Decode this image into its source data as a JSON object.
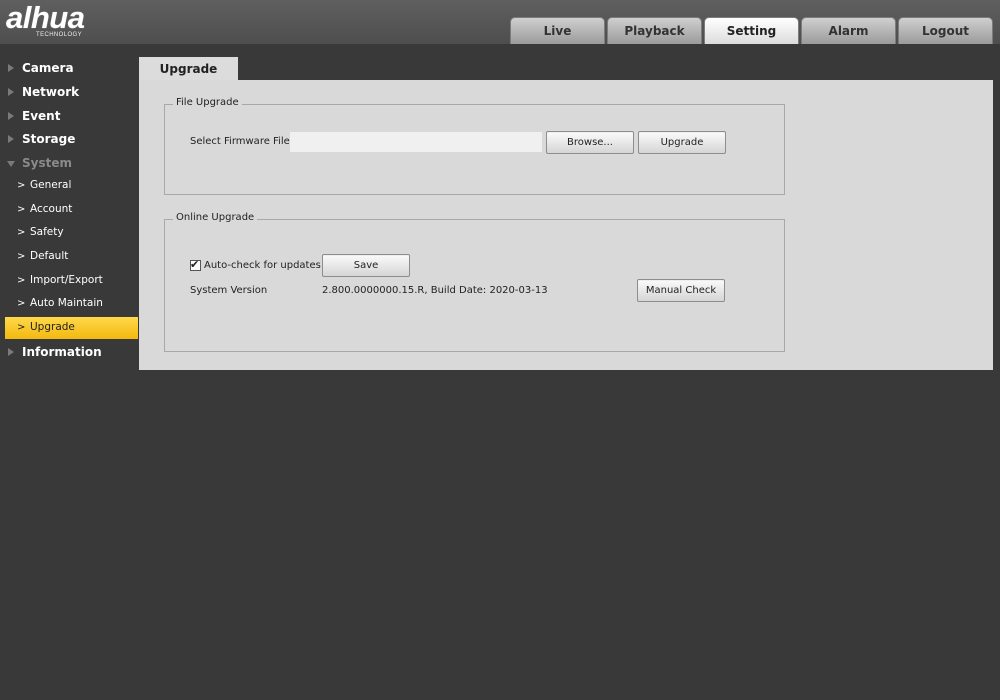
{
  "logo": {
    "brand": "alhua",
    "sub": "TECHNOLOGY"
  },
  "top_tabs": [
    {
      "label": "Live",
      "active": false
    },
    {
      "label": "Playback",
      "active": false
    },
    {
      "label": "Setting",
      "active": true
    },
    {
      "label": "Alarm",
      "active": false
    },
    {
      "label": "Logout",
      "active": false
    }
  ],
  "sidebar": {
    "camera": "Camera",
    "network": "Network",
    "event": "Event",
    "storage": "Storage",
    "system": "System",
    "system_items": [
      "General",
      "Account",
      "Safety",
      "Default",
      "Import/Export",
      "Auto Maintain",
      "Upgrade"
    ],
    "active_item": "Upgrade",
    "information": "Information"
  },
  "content_tab": "Upgrade",
  "file_upgrade": {
    "legend": "File Upgrade",
    "select_label": "Select Firmware File",
    "file_value": "",
    "browse_label": "Browse...",
    "upgrade_label": "Upgrade"
  },
  "online_upgrade": {
    "legend": "Online Upgrade",
    "auto_check_label": "Auto-check for updates",
    "auto_check": true,
    "save_label": "Save",
    "version_label": "System Version",
    "version_value": "2.800.0000000.15.R, Build Date: 2020-03-13",
    "manual_check_label": "Manual Check"
  },
  "icons": {
    "nav_collapsed": "triangle-right-icon",
    "nav_expanded": "triangle-down-icon",
    "sub_item": "chevron-right-icon",
    "checkbox_checked": "checkmark-icon"
  },
  "colors": {
    "active_item": "#f5c21c",
    "background": "#393939",
    "panel": "#d9d9d9"
  }
}
